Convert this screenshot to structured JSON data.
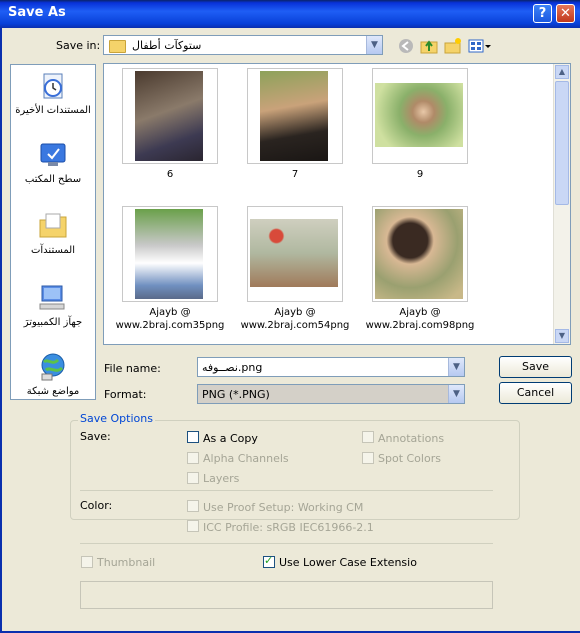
{
  "window": {
    "title": "Save As",
    "help_label": "?",
    "close_label": "✕"
  },
  "savein": {
    "label": "Save in:",
    "value": "ستوكآت أطفال"
  },
  "places": [
    {
      "label": "المستندات الأخيرة",
      "icon": "recent-documents-icon"
    },
    {
      "label": "سطح المكتب",
      "icon": "desktop-icon"
    },
    {
      "label": "المستندآت",
      "icon": "my-documents-icon"
    },
    {
      "label": "جهآز الكمبيوترَ",
      "icon": "my-computer-icon"
    },
    {
      "label": "مواضع شبكة",
      "icon": "network-places-icon"
    }
  ],
  "files": [
    {
      "caption1": "6",
      "caption2": ""
    },
    {
      "caption1": "7",
      "caption2": ""
    },
    {
      "caption1": "9",
      "caption2": ""
    },
    {
      "caption1": "Ajayb @",
      "caption2": "www.2braj.com35png"
    },
    {
      "caption1": "Ajayb @",
      "caption2": "www.2braj.com54png"
    },
    {
      "caption1": "Ajayb @",
      "caption2": "www.2braj.com98png"
    }
  ],
  "filename": {
    "label": "File name:",
    "value": "نصــوفه.png"
  },
  "format": {
    "label": "Format:",
    "value": "PNG (*.PNG)"
  },
  "buttons": {
    "save": "Save",
    "cancel": "Cancel"
  },
  "options": {
    "title": "Save Options",
    "save_label": "Save:",
    "as_copy": "As a Copy",
    "alpha_channels": "Alpha Channels",
    "layers": "Layers",
    "annotations": "Annotations",
    "spot_colors": "Spot Colors",
    "color_label": "Color:",
    "use_proof_setup": "Use Proof Setup:  Working CM",
    "icc_profile": "ICC Profile:  sRGB IEC61966-2.1",
    "thumbnail": "Thumbnail",
    "lower_case": "Use Lower Case Extensio"
  },
  "colors": {
    "titlebar": "#0840d8",
    "dialog": "#ece9d8",
    "accent_text": "#0046d5",
    "format_bg": "#d4d0c8"
  }
}
